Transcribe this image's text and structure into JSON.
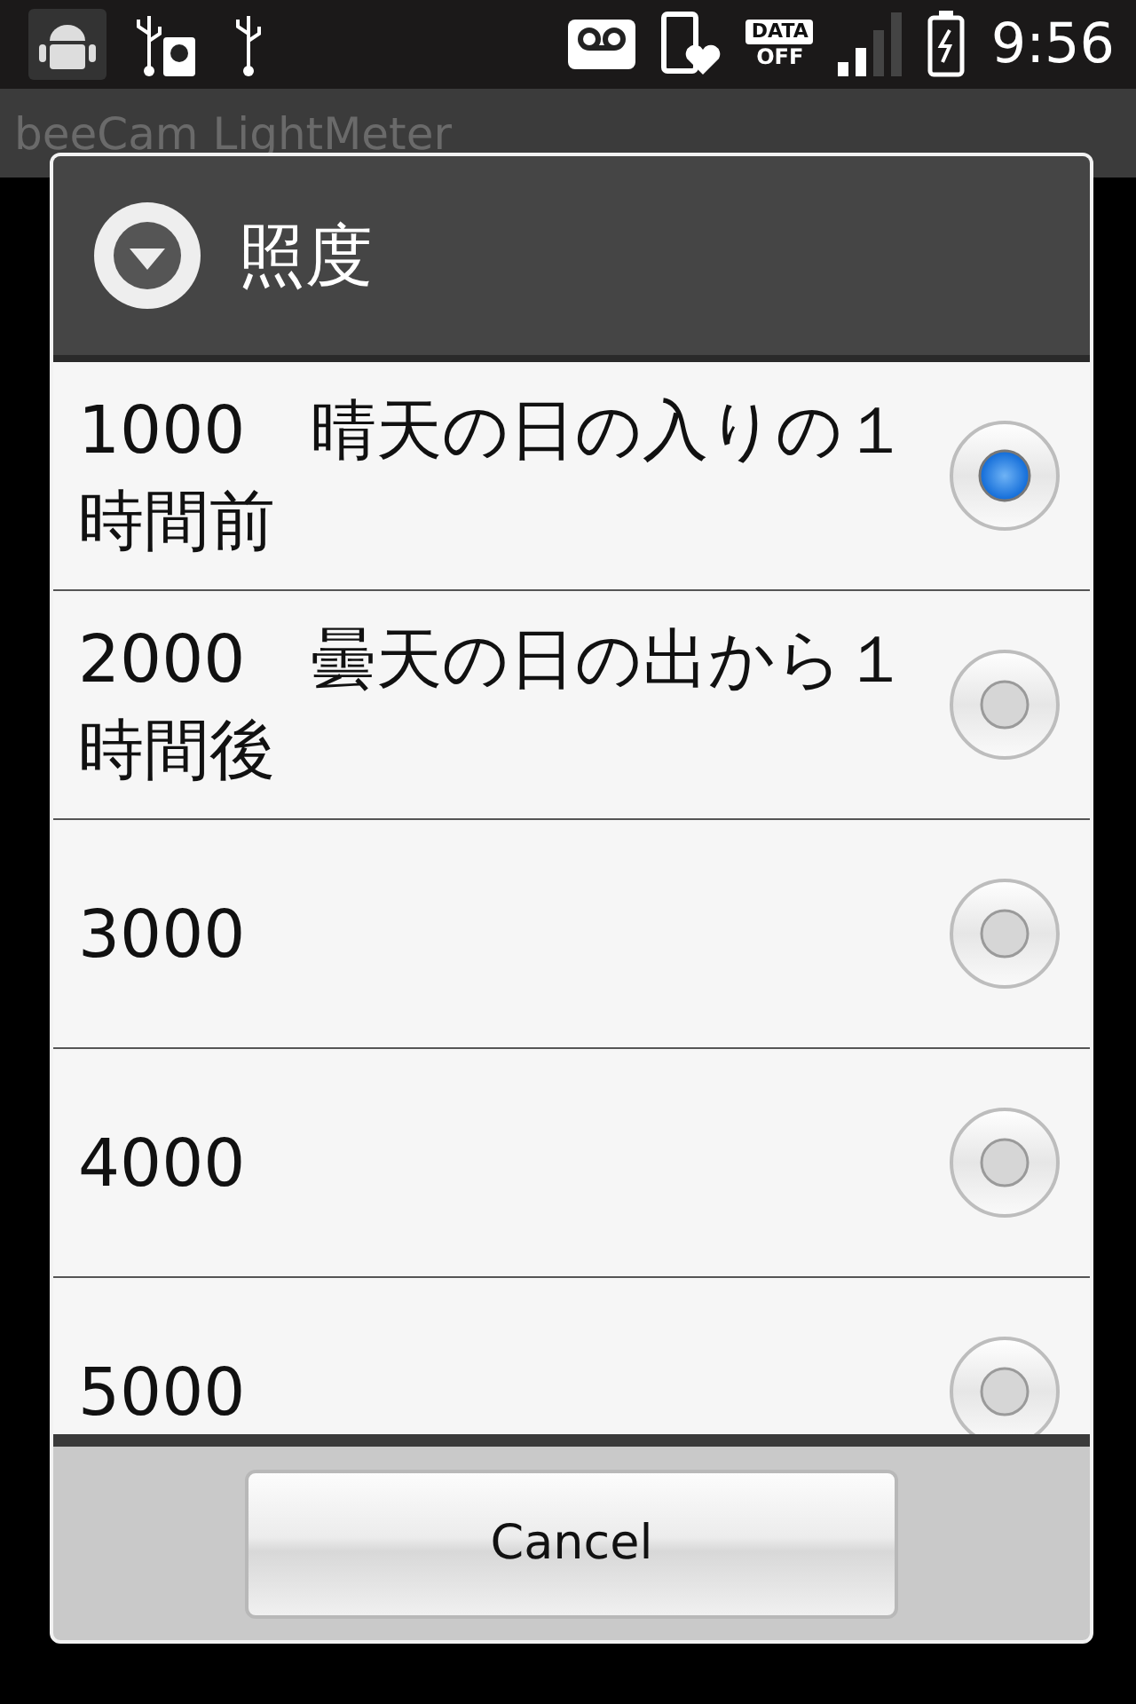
{
  "status_bar": {
    "data_top": "DATA",
    "data_bottom": "OFF",
    "time": "9:56"
  },
  "app_bar": {
    "title": "beeCam LightMeter"
  },
  "dialog": {
    "title": "照度",
    "options": [
      {
        "label": "1000　晴天の日の入りの１時間前",
        "selected": true
      },
      {
        "label": "2000　曇天の日の出から１時間後",
        "selected": false
      },
      {
        "label": "3000",
        "selected": false
      },
      {
        "label": "4000",
        "selected": false
      },
      {
        "label": "5000",
        "selected": false
      }
    ],
    "cancel": "Cancel"
  }
}
